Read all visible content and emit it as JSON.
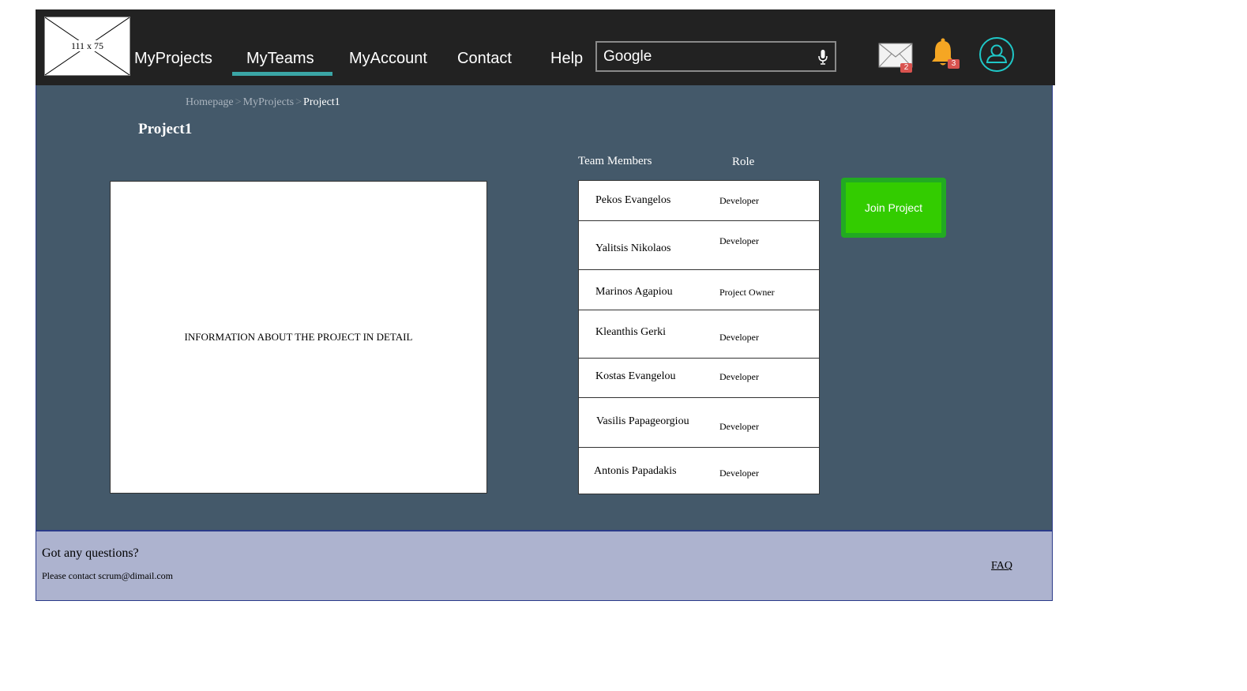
{
  "header": {
    "logo_label": "111 x 75",
    "nav": [
      {
        "label": "MyProjects"
      },
      {
        "label": "MyTeams",
        "active": true
      },
      {
        "label": "MyAccount"
      },
      {
        "label": "Contact"
      },
      {
        "label": "Help"
      }
    ],
    "search": {
      "brand": "Google",
      "icon": "microphone-icon"
    },
    "mail": {
      "icon": "mail-icon",
      "badge": "2"
    },
    "notifications": {
      "icon": "bell-icon",
      "badge": "3"
    },
    "account": {
      "icon": "user-icon"
    },
    "accent_color": "#3aa6a6"
  },
  "breadcrumb": {
    "items": [
      "Homepage",
      "MyProjects",
      "Project1"
    ],
    "separator": ">"
  },
  "page_title": "Project1",
  "info_text": "INFORMATION ABOUT THE PROJECT IN DETAIL",
  "team": {
    "members_header": "Team Members",
    "role_header": "Role",
    "members": [
      {
        "name": "Pekos Evangelos",
        "role": "Developer"
      },
      {
        "name": "Yalitsis Nikolaos",
        "role": "Developer"
      },
      {
        "name": "Marinos Agapiou",
        "role": "Project Owner"
      },
      {
        "name": "Kleanthis Gerki",
        "role": "Developer"
      },
      {
        "name": "Kostas Evangelou",
        "role": "Developer"
      },
      {
        "name": "Vasilis Papageorgiou",
        "role": "Developer"
      },
      {
        "name": "Antonis Papadakis",
        "role": "Developer"
      }
    ]
  },
  "join_button": {
    "label": "Join Project",
    "color": "#33cc00"
  },
  "footer": {
    "question": "Got any questions?",
    "contact": "Please contact scrum@dimail.com",
    "faq": "FAQ"
  }
}
